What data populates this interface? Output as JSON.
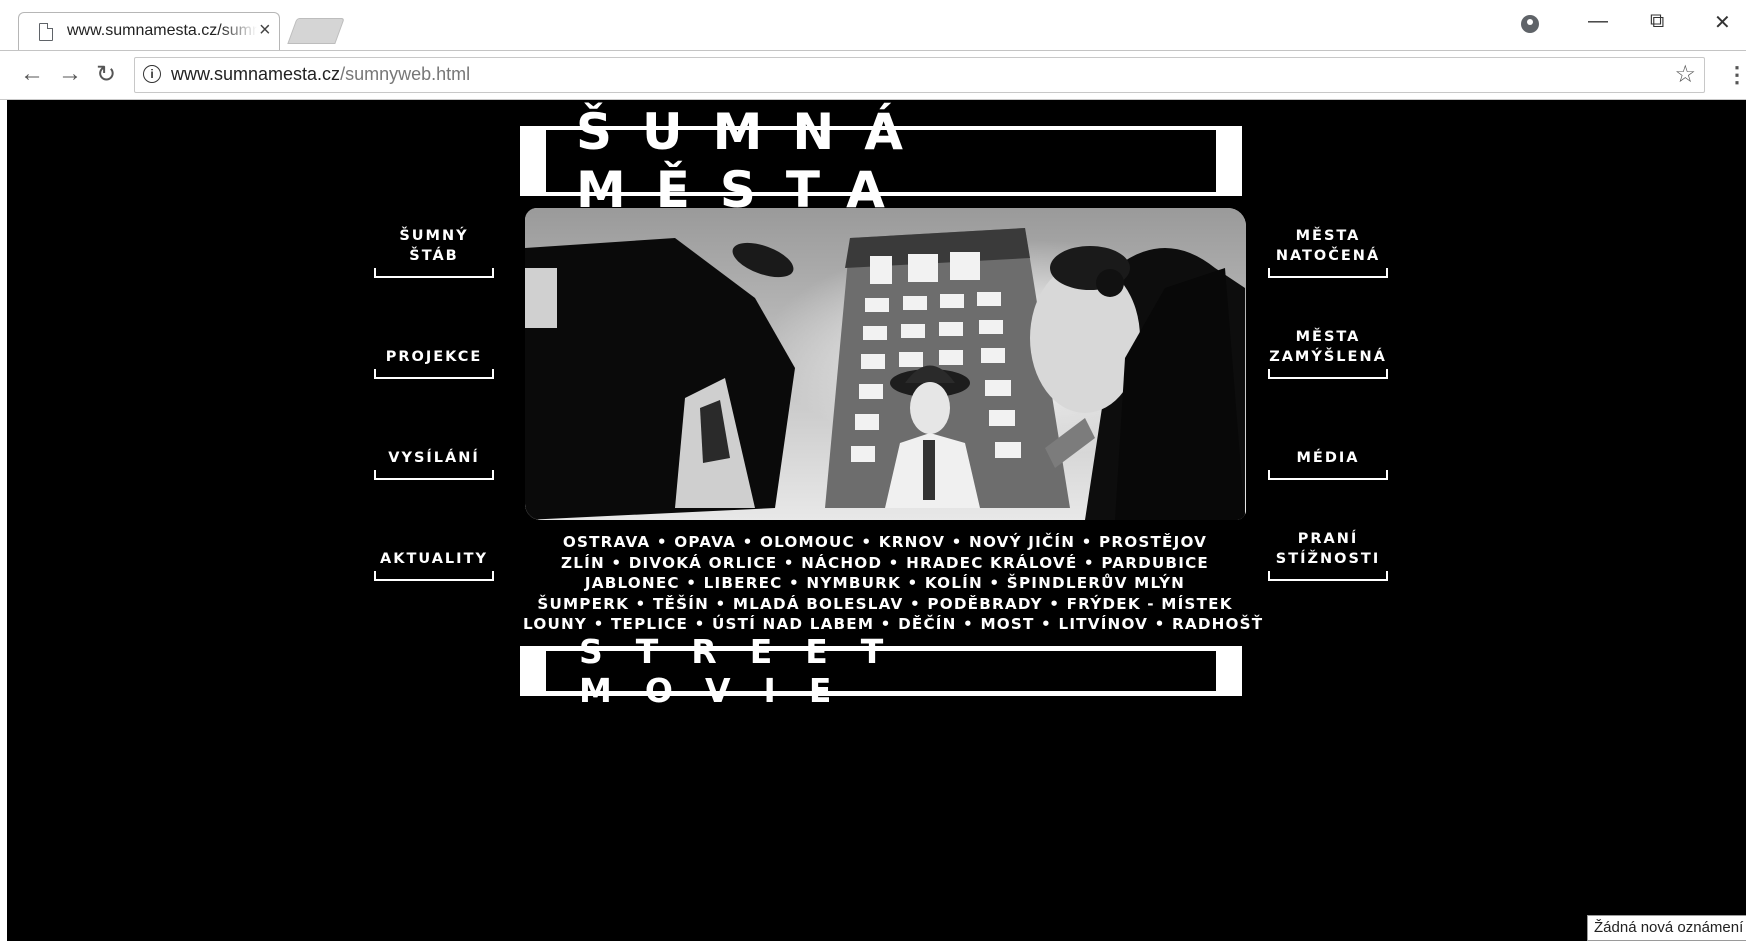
{
  "browser": {
    "tab_title": "www.sumnamesta.cz/sumnyweb.html",
    "tab_close": "×",
    "url_host": "www.sumnamesta.cz",
    "url_path": "/sumnyweb.html",
    "back_icon": "←",
    "forward_icon": "→",
    "reload_icon": "↻",
    "info_icon": "i",
    "star_icon": "☆",
    "menu_icon": "⋮",
    "minimize_icon": "—",
    "restore_icon": "⧉",
    "close_icon": "✕"
  },
  "page": {
    "title": "ŠUMNÁ MĚSTA",
    "subtitle": "STREET MOVIE",
    "cities": [
      "OSTRAVA • OPAVA • OLOMOUC • KRNOV • NOVÝ JIČÍN • PROSTĚJOV",
      "ZLÍN • DIVOKÁ ORLICE • NÁCHOD • HRADEC KRÁLOVÉ • PARDUBICE",
      "JABLONEC • LIBEREC • NYMBURK • KOLÍN • ŠPINDLERŮV MLÝN",
      "ŠUMPERK • TĚŠÍN • MLADÁ BOLESLAV • PODĚBRADY • FRÝDEK - MÍSTEK",
      "LOUNY • TEPLICE • ÚSTÍ NAD LABEM • DĚČÍN • MOST • LITVÍNOV • RADHOŠŤ"
    ],
    "nav_left": [
      {
        "line1": "ŠUMNÝ",
        "line2": "ŠTÁB"
      },
      {
        "line1": "",
        "line2": "PROJEKCE"
      },
      {
        "line1": "",
        "line2": "VYSÍLÁNÍ"
      },
      {
        "line1": "",
        "line2": "AKTUALITY"
      }
    ],
    "nav_right": [
      {
        "line1": "MĚSTA",
        "line2": "NATOČENÁ"
      },
      {
        "line1": "MĚSTA",
        "line2": "ZAMÝŠLENÁ"
      },
      {
        "line1": "",
        "line2": "MÉDIA"
      },
      {
        "line1": "PRANÍ",
        "line2": "STÍŽNOSTI"
      }
    ]
  },
  "status": {
    "notification": "Žádná nová oznámení"
  }
}
